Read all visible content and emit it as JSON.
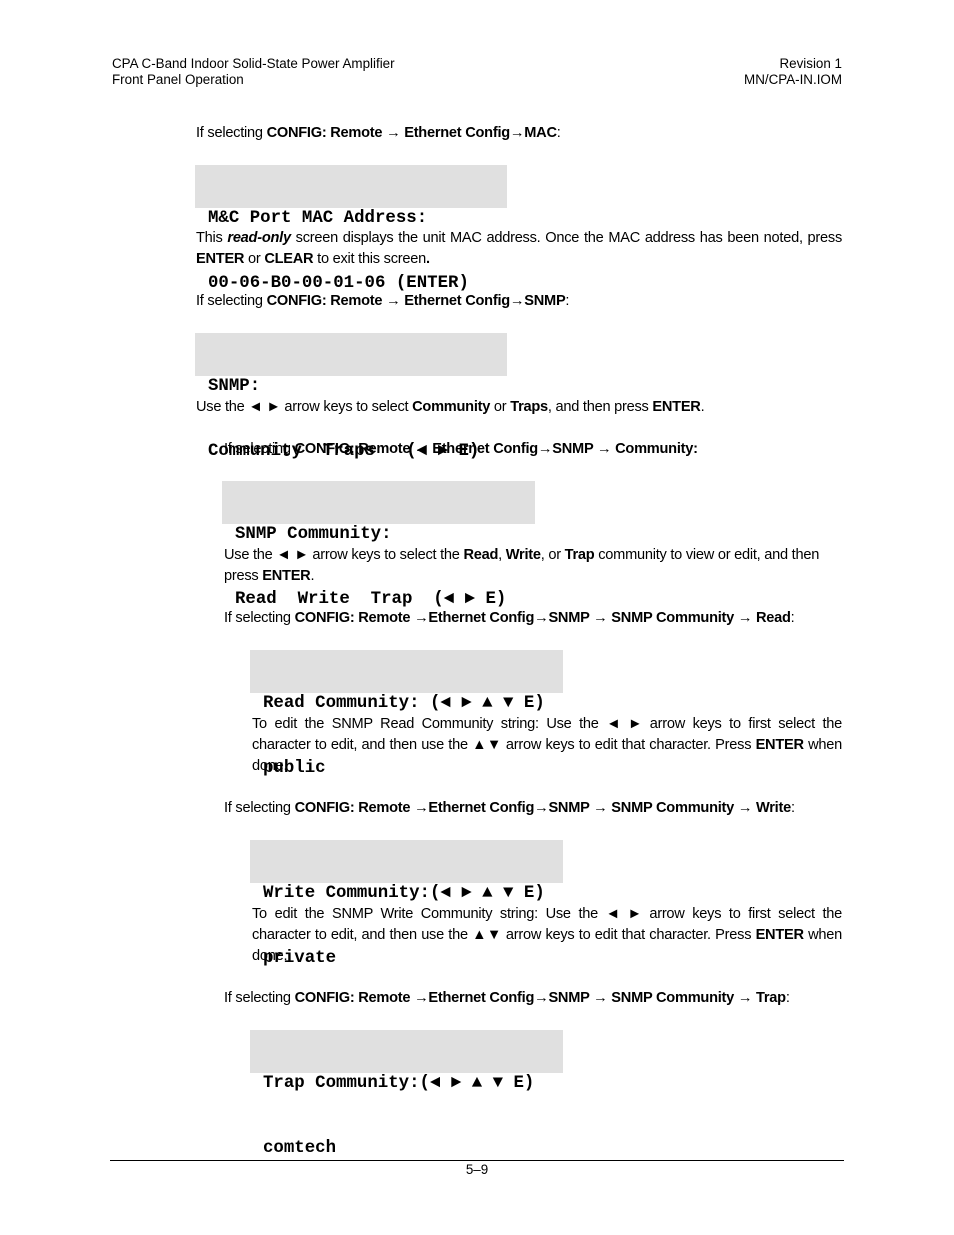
{
  "header": {
    "left_line1": "CPA C-Band Indoor Solid-State Power Amplifier",
    "left_line2": "Front Panel Operation",
    "right_line1": "Revision 1",
    "right_line2": "MN/CPA-IN.IOM"
  },
  "sections": {
    "mac": {
      "intro_prefix": "If selecting ",
      "intro_path": "CONFIG: Remote → Ethernet Config→MAC",
      "intro_suffix": ":",
      "lcd_line1": "M&C Port MAC Address:",
      "lcd_line2": "00-06-B0-00-01-06 (ENTER)",
      "desc_1": "This ",
      "desc_em": "read-only",
      "desc_2": " screen displays the unit MAC address. Once the MAC address has been noted, press ",
      "desc_enter": "ENTER",
      "desc_3": " or ",
      "desc_clear": "CLEAR",
      "desc_4": " to exit this screen",
      "desc_end": "."
    },
    "snmp": {
      "intro_prefix": "If selecting ",
      "intro_path": "CONFIG: Remote → Ethernet Config→SNMP",
      "intro_suffix": ":",
      "lcd_line1": "SNMP:",
      "lcd_line2": "Community  Traps   (◄ ► E)",
      "desc_1": "Use the ◄  ► arrow keys to select ",
      "desc_community": "Community",
      "desc_2": " or ",
      "desc_traps": "Traps",
      "desc_3": ", and then press ",
      "desc_enter": "ENTER",
      "desc_4": "."
    },
    "community": {
      "intro_prefix": "If selecting ",
      "intro_path": "CONFIG: Remote → Ethernet Config→SNMP → Community:",
      "lcd_line1": "SNMP Community:",
      "lcd_line2": "Read  Write  Trap  (◄ ► E)",
      "desc_1": "Use the ◄  ► arrow keys to select the ",
      "desc_read": "Read",
      "desc_2": ", ",
      "desc_write": "Write",
      "desc_3": ", or ",
      "desc_trap": "Trap",
      "desc_4": " community to view or edit, and then press ",
      "desc_enter": "ENTER",
      "desc_5": "."
    },
    "read": {
      "intro_prefix": "If selecting ",
      "intro_path": "CONFIG: Remote →Ethernet Config→SNMP → SNMP Community → Read",
      "intro_suffix": ":",
      "lcd_line1": "Read Community: (◄ ► ▲ ▼ E)",
      "lcd_line2": "public",
      "desc_1": "To edit the SNMP Read Community string: Use the ◄  ►  arrow keys to first select the character to edit, and then use the ▲▼ arrow keys to edit that character. Press ",
      "desc_enter": "ENTER",
      "desc_2": " when done."
    },
    "write": {
      "intro_prefix": "If selecting ",
      "intro_path": "CONFIG: Remote →Ethernet Config→SNMP → SNMP Community →  Write",
      "intro_suffix": ":",
      "lcd_line1": "Write Community:(◄ ► ▲ ▼ E)",
      "lcd_line2": "private",
      "desc_1": "To edit the SNMP Write Community string: Use the ◄  ►  arrow keys to first select the character to edit, and then use the ▲▼ arrow keys to edit that character. Press ",
      "desc_enter": "ENTER",
      "desc_2": " when done."
    },
    "trap": {
      "intro_prefix": "If selecting ",
      "intro_path": "CONFIG: Remote →Ethernet Config→SNMP → SNMP Community → Trap",
      "intro_suffix": ":",
      "lcd_line1": "Trap Community:(◄ ► ▲ ▼ E)",
      "lcd_line2": "comtech"
    }
  },
  "footer": {
    "page_number": "5–9"
  }
}
